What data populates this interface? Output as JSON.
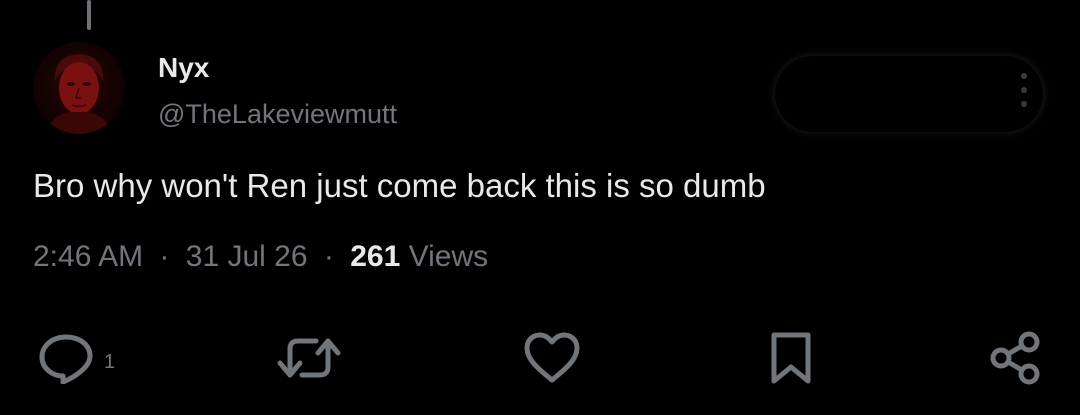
{
  "thread": {
    "connector": "thread-line"
  },
  "author": {
    "name": "Nyx",
    "handle": "@TheLakeviewmutt",
    "avatar_icon": "profile-photo"
  },
  "tweet": {
    "text": "Bro why won't Ren just come back this is so dumb"
  },
  "meta": {
    "time": "2:46 AM",
    "separator": "·",
    "date": "31 Jul 26",
    "views_count": "261",
    "views_label": "Views"
  },
  "actions": {
    "reply": {
      "icon": "reply-icon",
      "count": "1"
    },
    "retweet": {
      "icon": "retweet-icon"
    },
    "like": {
      "icon": "heart-icon"
    },
    "bookmark": {
      "icon": "bookmark-icon"
    },
    "share": {
      "icon": "share-icon"
    }
  },
  "colors": {
    "background": "#000000",
    "primary_text": "#e7e9ea",
    "secondary_text": "#71767b",
    "icon": "#71767b"
  }
}
